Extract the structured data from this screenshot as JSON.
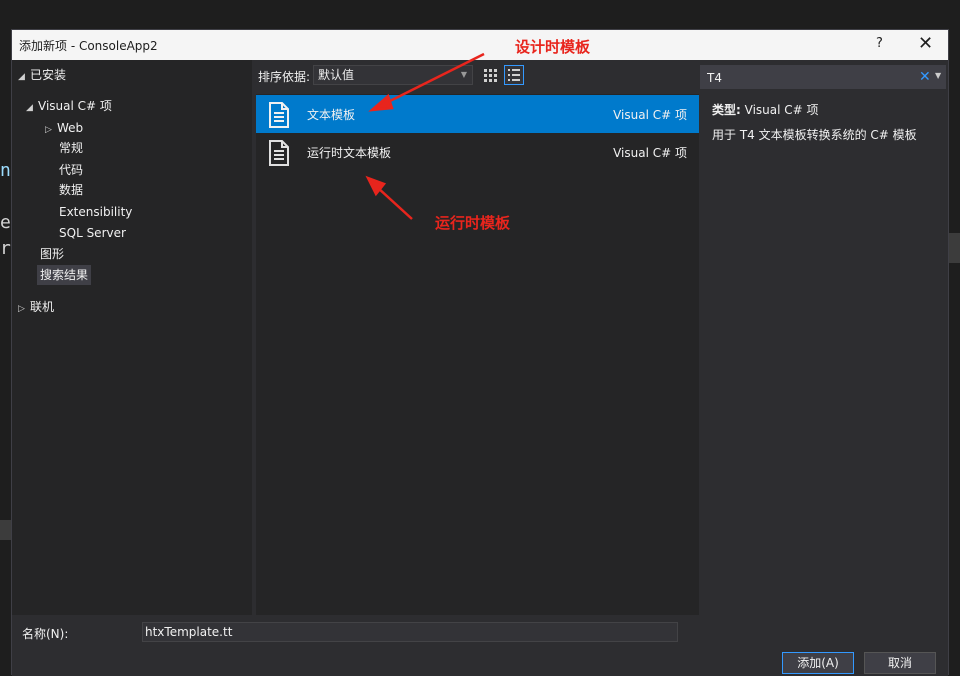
{
  "dialog": {
    "title": "添加新项 - ConsoleApp2",
    "help": "?",
    "close": "✕"
  },
  "tree": {
    "installed": "已安装",
    "visual_csharp": "Visual C# 项",
    "web": "Web",
    "normal": "常规",
    "code": "代码",
    "data": "数据",
    "extensibility": "Extensibility",
    "sql_server": "SQL Server",
    "graphics": "图形",
    "search_results": "搜索结果",
    "online": "联机"
  },
  "toolbar": {
    "sort_label": "排序依据:",
    "sort_value": "默认值"
  },
  "search": {
    "value": "T4"
  },
  "templates": [
    {
      "name": "文本模板",
      "lang": "Visual C# 项"
    },
    {
      "name": "运行时文本模板",
      "lang": "Visual C# 项"
    }
  ],
  "details": {
    "type_label": "类型:",
    "type_value": "Visual C# 项",
    "description": "用于 T4 文本模板转换系统的 C# 模板"
  },
  "bottom": {
    "name_label": "名称(N):",
    "name_value": "htxTemplate.tt",
    "add_button": "添加(A)",
    "cancel_button": "取消"
  },
  "annotations": {
    "design_time": "设计时模板",
    "runtime": "运行时模板"
  },
  "colors": {
    "accent": "#007acc",
    "annotation": "#e8251d"
  }
}
